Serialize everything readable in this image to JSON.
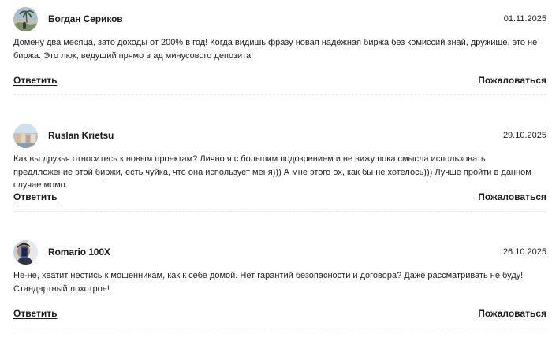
{
  "comments": [
    {
      "author": "Богдан Сериков",
      "date": "01.11.2025",
      "text": "Домену два месяца, зато доходы от 200% в год! Когда видишь фразу новая надёжная биржа без комиссий знай, дружище, это не биржа. Это люк, ведущий прямо в ад минусового депозита!",
      "reply_label": "Ответить",
      "report_label": "Пожаловаться"
    },
    {
      "author": "Ruslan Krietsu",
      "date": "29.10.2025",
      "text": "Как вы друзья относитесь к новым проектам? Лично я с большим подозрением и не вижу пока смысла использовать предлложение этой биржи, есть чуйка, что она использует меня))) А мне этого ох, как бы не хотелось))) Лучше пройти в данном случае момо.",
      "reply_label": "Ответить",
      "report_label": "Пожаловаться"
    },
    {
      "author": "Romario 100X",
      "date": "26.10.2025",
      "text": "Не-не, хватит нестись к мошенникам, как к себе домой. Нет гарантий безопасности и договора? Даже рассматривать не буду! Стандартный лохотрон!",
      "reply_label": "Ответить",
      "report_label": "Пожаловаться"
    }
  ]
}
